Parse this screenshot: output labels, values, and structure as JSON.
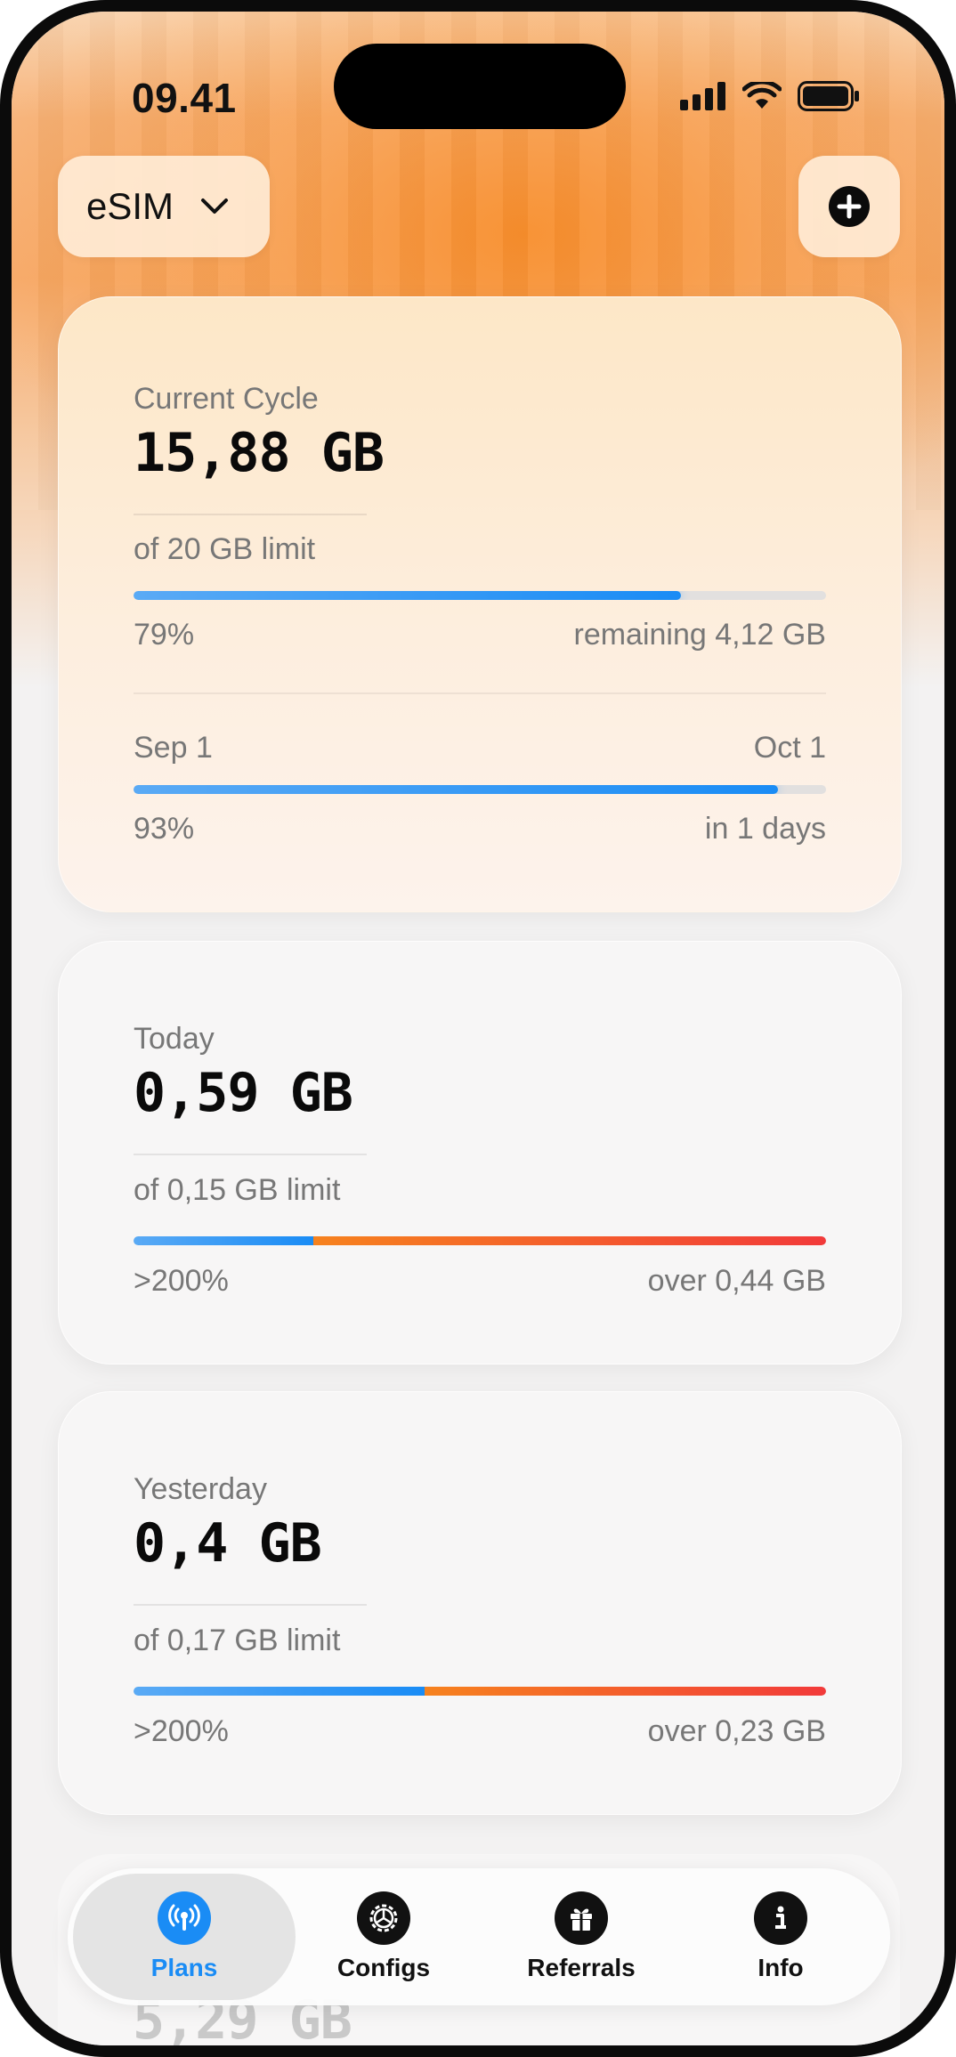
{
  "status_bar": {
    "time": "09.41"
  },
  "header": {
    "selector_label": "eSIM"
  },
  "cards": [
    {
      "title": "Current Cycle",
      "value": "15,88 GB",
      "limit": "of 20 GB limit",
      "percent": "79%",
      "right_text": "remaining 4,12 GB",
      "progress": 0.79,
      "period": {
        "start": "Sep 1",
        "end": "Oct 1",
        "percent": "93%",
        "right_text": "in 1 days",
        "progress": 0.93
      }
    },
    {
      "title": "Today",
      "value": "0,59 GB",
      "limit": "of 0,15 GB limit",
      "percent": ">200%",
      "right_text": "over 0,44 GB",
      "limit_fraction": 0.26
    },
    {
      "title": "Yesterday",
      "value": "0,4 GB",
      "limit": "of 0,17 GB limit",
      "percent": ">200%",
      "right_text": "over 0,23 GB",
      "limit_fraction": 0.42
    },
    {
      "value": "5,29 GB"
    }
  ],
  "tabbar": {
    "items": [
      {
        "label": "Plans",
        "icon": "antenna-icon",
        "active": true
      },
      {
        "label": "Configs",
        "icon": "gear-icon",
        "active": false
      },
      {
        "label": "Referrals",
        "icon": "gift-icon",
        "active": false
      },
      {
        "label": "Info",
        "icon": "info-icon",
        "active": false
      }
    ]
  },
  "colors": {
    "accent": "#1a8cf5",
    "over_start": "#f6821e",
    "over_end": "#f23a3a"
  }
}
